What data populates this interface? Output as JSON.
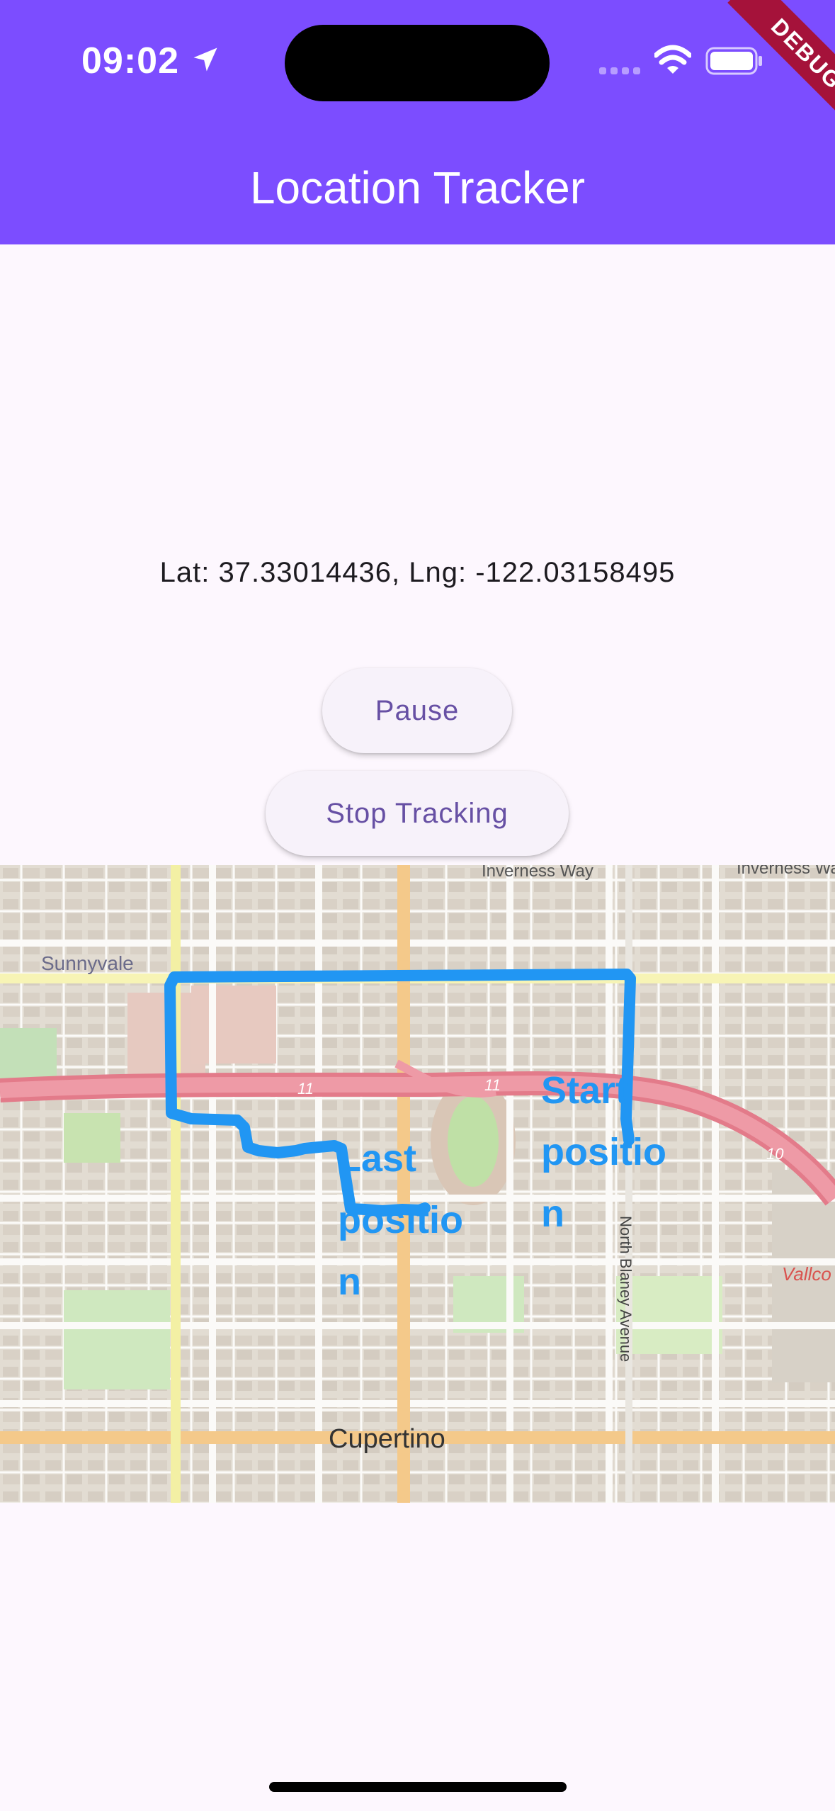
{
  "status_bar": {
    "time": "09:02",
    "icons": [
      "location-arrow-icon",
      "cellular-signal-icon",
      "wifi-icon",
      "battery-icon"
    ]
  },
  "app_bar": {
    "title": "Location Tracker",
    "color": "#7c4dff"
  },
  "debug_banner": {
    "label": "DEBUG"
  },
  "location": {
    "text": "Lat: 37.33014436, Lng: -122.03158495"
  },
  "buttons": {
    "pause": "Pause",
    "stop": "Stop Tracking"
  },
  "map": {
    "labels": {
      "sunnyvale": "Sunnyvale",
      "cupertino": "Cupertino",
      "inverness_way_1": "Inverness Way",
      "inverness_way_2": "Inverness Wa",
      "north_blaney": "North Blaney Avenue",
      "highway_11a": "11",
      "highway_11b": "11",
      "highway_10": "10",
      "vallco": "Vallco"
    },
    "markers": {
      "start": [
        "Start",
        "positio",
        "n"
      ],
      "last": [
        "Last",
        "positio",
        "n"
      ]
    },
    "route_color": "#2196f3"
  }
}
